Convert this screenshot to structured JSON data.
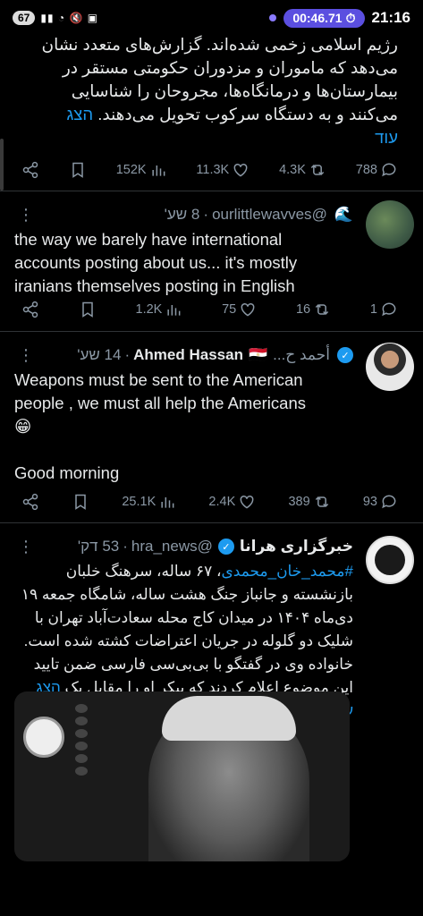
{
  "status_bar": {
    "battery": "67",
    "timer": "00:46.71",
    "clock": "21:16"
  },
  "tweet1": {
    "text_lines": [
      "رژیم اسلامی زخمی شده‌اند. گزارش‌های متعدد نشان",
      "می‌دهد که ماموران و مزدوران حکومتی مستقر در",
      "بیمارستان‌ها و درمانگاه‌ها، مجروحان را شناسایی",
      "می‌کنند و به دستگاه سرکوب تحویل می‌دهند."
    ],
    "show_more": "הצג",
    "show_more_2": "עוד",
    "stats": {
      "views": "152K",
      "likes": "11.3K",
      "retweets": "4.3K",
      "replies": "788"
    }
  },
  "tweet2": {
    "time": "8 שע'",
    "handle": "@ourlittlewavves",
    "emoji": "🌊",
    "text_lines": [
      "the way we barely have international",
      "accounts posting about us... it's mostly",
      "iranians themselves posting in English"
    ],
    "stats": {
      "views": "1.2K",
      "likes": "75",
      "retweets": "16",
      "replies": "1"
    }
  },
  "tweet3": {
    "time": "14 שע'",
    "name": "Ahmed Hassan",
    "name_ar": "أحمد ح...",
    "flag": "🇪🇬",
    "text_lines": [
      "Weapons must be sent to the American",
      "people , we must all help the Americans"
    ],
    "emoji": "😁",
    "text_tail": "Good morning",
    "stats": {
      "views": "25.1K",
      "likes": "2.4K",
      "retweets": "389",
      "replies": "93"
    }
  },
  "tweet4": {
    "time": "53 דק'",
    "handle": "@hra_news",
    "name": "خبرگزاری هرانا",
    "hashtag": "#محمد_خان_محمدی",
    "text_first": "، ۶۷ ساله، سرهنگ خلبان",
    "text_lines": [
      "بازنشسته و جانباز جنگ هشت ساله، شامگاه جمعه ۱۹",
      "دی‌ماه ۱۴۰۴ در میدان کاج محله سعادت‌آباد تهران با",
      "شلیک دو گلوله در جریان اعتراضات کشته شده است.",
      "خانواده وی در گفتگو با بی‌بی‌سی فارسی ضمن تایید",
      "این موضوع اعلام کردند که پیکر او را مقابل یک"
    ],
    "show_more": "הצג",
    "show_more_2": "עוד"
  },
  "colors": {
    "link": "#1d9bf0",
    "muted": "#8b98a5",
    "bg": "#000000",
    "divider": "#2f3336"
  }
}
